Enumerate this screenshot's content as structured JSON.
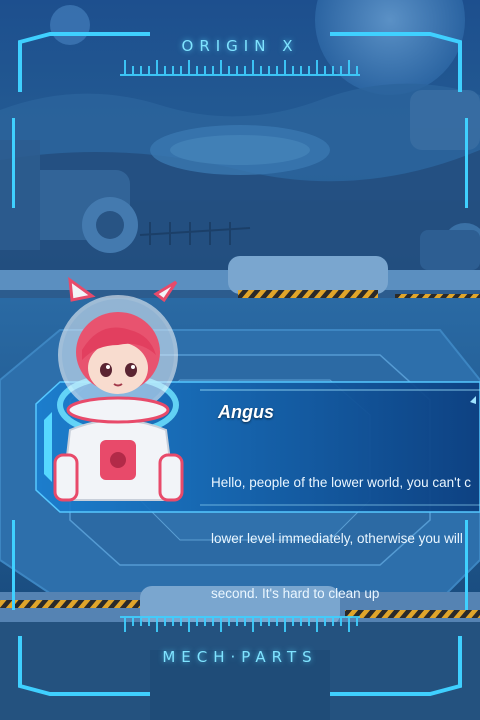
{
  "hud": {
    "top_title": "ORIGIN  X",
    "bottom_title": "MECH·PARTS"
  },
  "dialog": {
    "speaker": "Angus",
    "lines": [
      "Hello, people of the lower world, you can't c",
      "lower level immediately, otherwise you will",
      "second. It's hard to clean up"
    ]
  },
  "colors": {
    "hud_cyan": "#3fd0ff",
    "panel_blue": "#1f5fa0",
    "hazard_yellow": "#e0a52a",
    "suit_pink": "#e84a6a"
  },
  "icons": [
    "corner-bracket-icon",
    "character-portrait"
  ]
}
